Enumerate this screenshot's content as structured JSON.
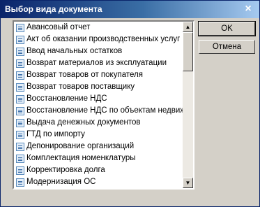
{
  "window": {
    "title": "Выбор вида документа",
    "close_icon": "×"
  },
  "buttons": {
    "ok": "OK",
    "cancel": "Отмена"
  },
  "list": {
    "items": [
      {
        "label": "Авансовый отчет"
      },
      {
        "label": "Акт об оказании производственных услуг"
      },
      {
        "label": "Ввод начальных остатков"
      },
      {
        "label": "Возврат материалов из эксплуатации"
      },
      {
        "label": "Возврат товаров от покупателя"
      },
      {
        "label": "Возврат товаров поставщику"
      },
      {
        "label": "Восстановление НДС"
      },
      {
        "label": "Восстановление НДС по объектам недвижи"
      },
      {
        "label": "Выдача денежных документов"
      },
      {
        "label": "ГТД по импорту"
      },
      {
        "label": "Депонирование организаций"
      },
      {
        "label": "Комплектация номенклатуры"
      },
      {
        "label": "Корректировка долга"
      },
      {
        "label": "Модернизация ОС"
      }
    ],
    "scroll_up_icon": "▲",
    "scroll_down_icon": "▼"
  }
}
